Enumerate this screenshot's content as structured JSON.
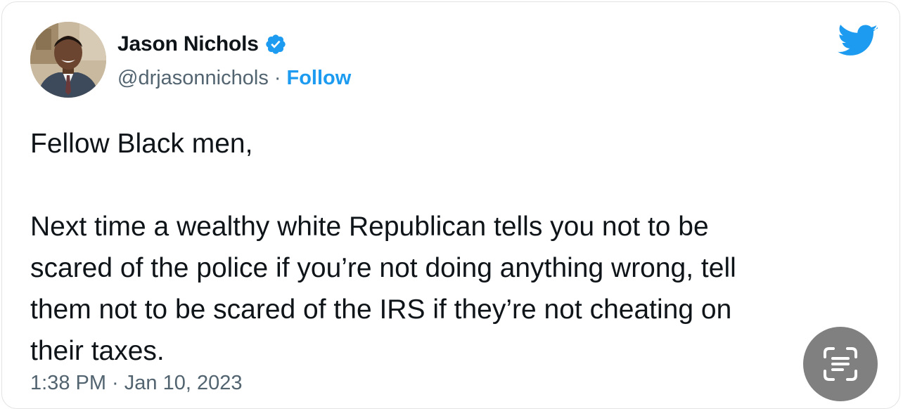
{
  "author": {
    "display_name": "Jason Nichols",
    "handle": "@drjasonnichols",
    "separator": "·",
    "follow_label": "Follow",
    "verified": true
  },
  "tweet": {
    "greeting": "Fellow Black men,",
    "lines": [
      "Next time a wealthy white Republican tells you not to be",
      "scared of the police if you’re not doing anything wrong, tell",
      "them not to be scared of the IRS if they’re not cheating on",
      "their taxes."
    ],
    "timestamp": "1:38 PM · Jan 10, 2023"
  },
  "icons": {
    "brand": "twitter-bird-icon",
    "verified": "verified-badge-icon",
    "overlay": "live-text-scan-icon"
  },
  "colors": {
    "accent": "#1d9bf0",
    "text": "#0f1419",
    "secondary": "#536471"
  }
}
